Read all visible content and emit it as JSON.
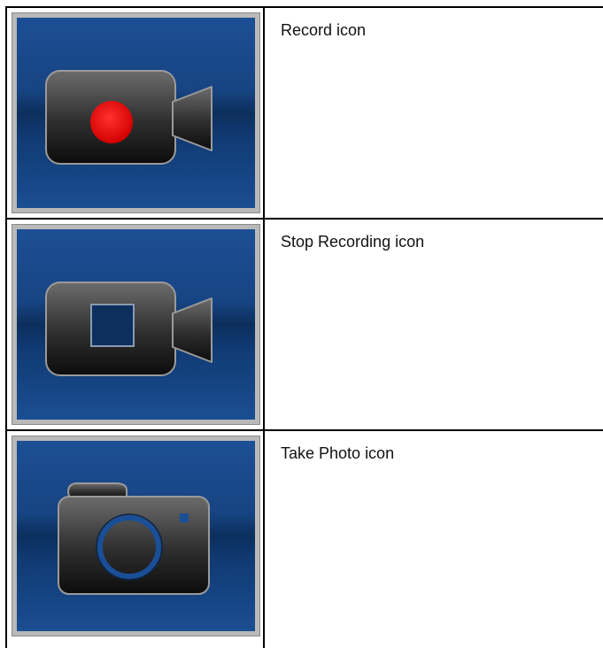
{
  "rows": [
    {
      "icon": "video-camera-record-icon",
      "label": "Record icon",
      "accent": "#e10d0d"
    },
    {
      "icon": "video-camera-stop-icon",
      "label": "Stop Recording icon",
      "accent": "#0c2f5d"
    },
    {
      "icon": "photo-camera-icon",
      "label": "Take Photo icon",
      "accent": "#1a4f98"
    }
  ],
  "colors": {
    "tile_background": "#174482",
    "tile_frame": "#b9b9b9",
    "icon_body": "#2a2a2a"
  }
}
